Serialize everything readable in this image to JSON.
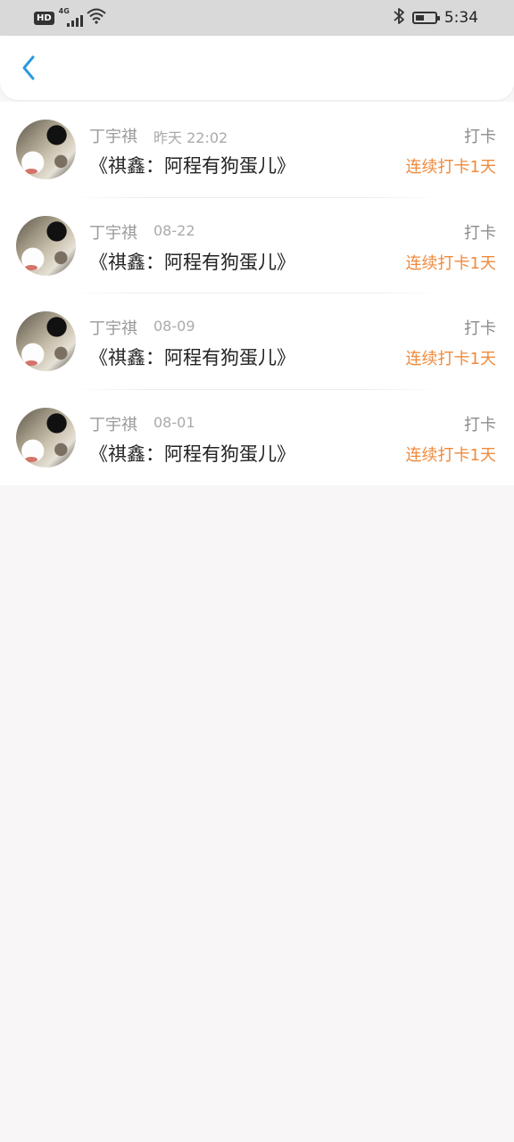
{
  "status_bar": {
    "hd_label": "HD",
    "network_label": "4G",
    "time": "5:34",
    "battery_level": 0.45
  },
  "nav": {
    "back_icon": "chevron-left-icon",
    "accent_color": "#2b9be0"
  },
  "colors": {
    "streak": "#ef8a3c"
  },
  "items": [
    {
      "author": "丁宇祺",
      "date": "昨天 22:02",
      "title": "《祺鑫：阿程有狗蛋儿》",
      "action": "打卡",
      "streak": "连续打卡1天"
    },
    {
      "author": "丁宇祺",
      "date": "08-22",
      "title": "《祺鑫：阿程有狗蛋儿》",
      "action": "打卡",
      "streak": "连续打卡1天"
    },
    {
      "author": "丁宇祺",
      "date": "08-09",
      "title": "《祺鑫：阿程有狗蛋儿》",
      "action": "打卡",
      "streak": "连续打卡1天"
    },
    {
      "author": "丁宇祺",
      "date": "08-01",
      "title": "《祺鑫：阿程有狗蛋儿》",
      "action": "打卡",
      "streak": "连续打卡1天"
    }
  ]
}
